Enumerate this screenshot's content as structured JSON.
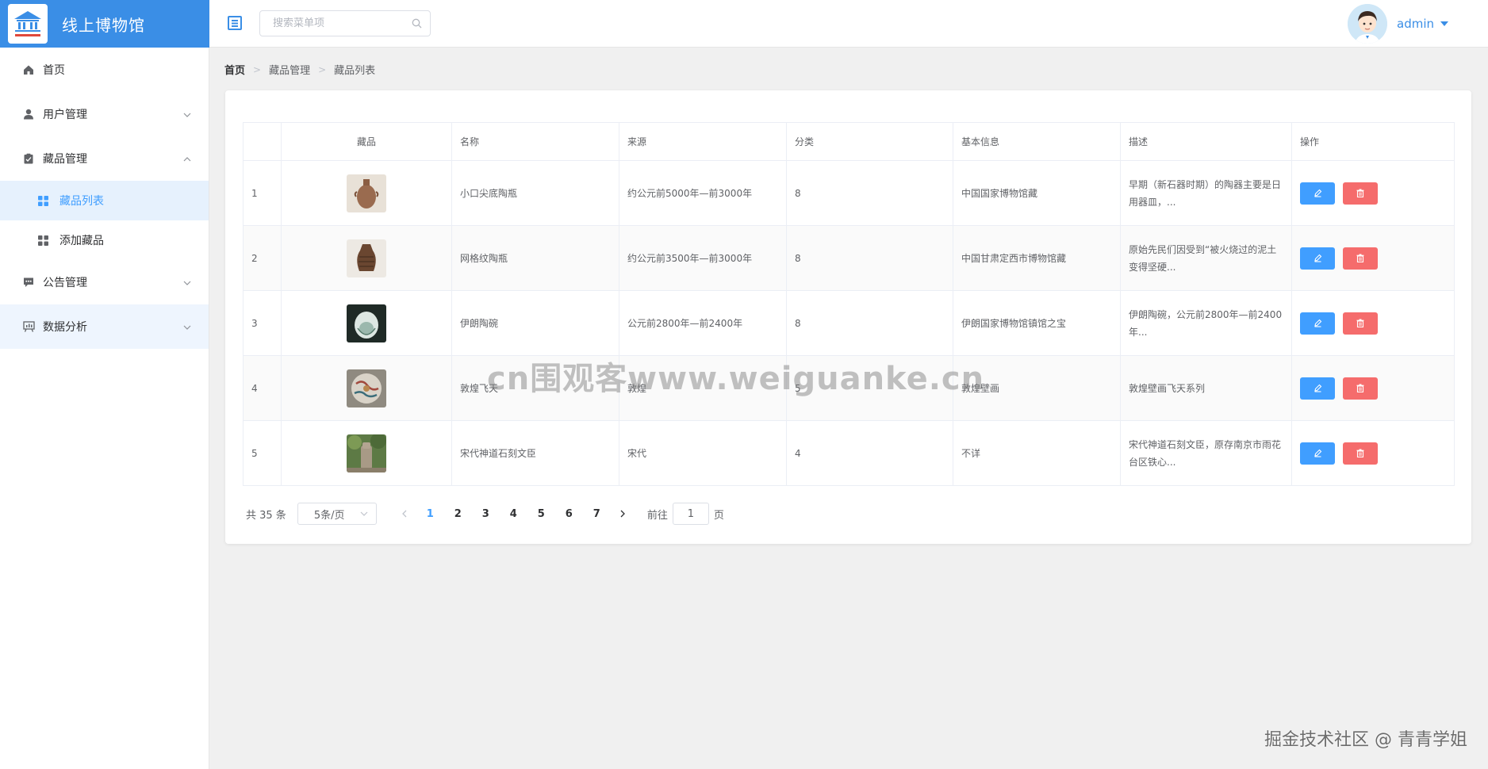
{
  "app": {
    "title": "线上博物馆",
    "logo_text": "线上博物馆"
  },
  "header": {
    "search_placeholder": "搜索菜单项",
    "user_name": "admin"
  },
  "sidebar": {
    "items": [
      {
        "label": "首页"
      },
      {
        "label": "用户管理"
      },
      {
        "label": "藏品管理"
      },
      {
        "label": "公告管理"
      },
      {
        "label": "数据分析"
      }
    ],
    "sub_items": [
      {
        "label": "藏品列表"
      },
      {
        "label": "添加藏品"
      }
    ]
  },
  "breadcrumb": [
    "首页",
    "藏品管理",
    "藏品列表"
  ],
  "table": {
    "columns": [
      "",
      "藏品",
      "名称",
      "来源",
      "分类",
      "基本信息",
      "描述",
      "操作"
    ],
    "rows": [
      {
        "index": "1",
        "name": "小口尖底陶瓶",
        "origin": "约公元前5000年—前3000年",
        "category": "8",
        "info": "中国国家博物馆藏",
        "desc": "早期（新石器时期）的陶器主要是日用器皿，..."
      },
      {
        "index": "2",
        "name": "网格纹陶瓶",
        "origin": "约公元前3500年—前3000年",
        "category": "8",
        "info": "中国甘肃定西市博物馆藏",
        "desc": "原始先民们因受到“被火烧过的泥土变得坚硬..."
      },
      {
        "index": "3",
        "name": "伊朗陶碗",
        "origin": "公元前2800年—前2400年",
        "category": "8",
        "info": "伊朗国家博物馆镇馆之宝",
        "desc": "伊朗陶碗，公元前2800年—前2400年..."
      },
      {
        "index": "4",
        "name": "敦煌飞天",
        "origin": "敦煌",
        "category": "5",
        "info": "敦煌壁画",
        "desc": "敦煌壁画飞天系列"
      },
      {
        "index": "5",
        "name": "宋代神道石刻文臣",
        "origin": "宋代",
        "category": "4",
        "info": "不详",
        "desc": "宋代神道石刻文臣，原存南京市雨花台区铁心..."
      }
    ]
  },
  "pagination": {
    "total": "共 35 条",
    "page_size": "5条/页",
    "pages": [
      "1",
      "2",
      "3",
      "4",
      "5",
      "6",
      "7"
    ],
    "current": "1",
    "goto_label": "前往",
    "goto_value": "1",
    "page_unit": "页"
  },
  "watermarks": {
    "center": "cn围观客www.weiguanke.cn",
    "corner": "掘金技术社区 @ 青青学姐"
  },
  "colors": {
    "primary": "#409eff",
    "danger": "#f56c6c",
    "logo_bg": "#3a8ee6"
  }
}
